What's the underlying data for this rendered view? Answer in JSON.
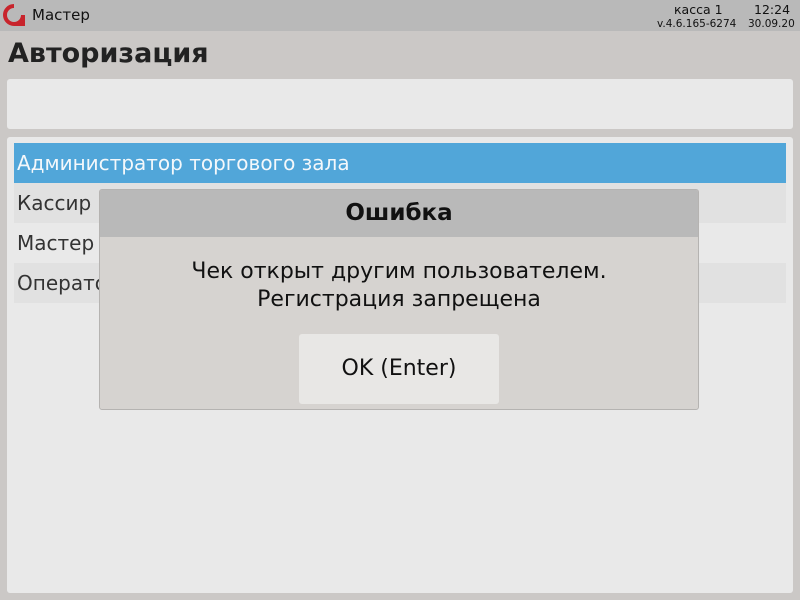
{
  "topbar": {
    "user": "Мастер",
    "kassa": "касса 1",
    "time": "12:24",
    "version": "v.4.6.165-6274",
    "date": "30.09.20"
  },
  "page": {
    "title": "Авторизация"
  },
  "roles": [
    {
      "label": "Администратор торгового зала",
      "selected": true
    },
    {
      "label": "Кассир",
      "selected": false
    },
    {
      "label": "Мастер",
      "selected": false
    },
    {
      "label": "Оператор",
      "selected": false
    }
  ],
  "dialog": {
    "title": "Ошибка",
    "message_line1": "Чек открыт другим пользователем.",
    "message_line2": "Регистрация запрещена",
    "ok_label": "OK (Enter)"
  },
  "colors": {
    "selected": "#51a6d9",
    "logo": "#c8242c"
  }
}
